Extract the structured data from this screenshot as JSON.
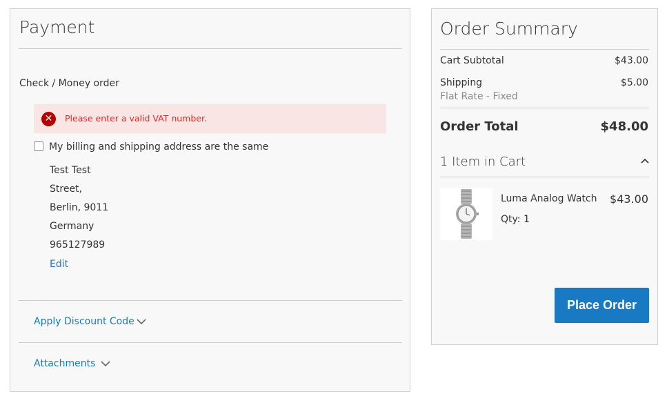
{
  "payment": {
    "title": "Payment",
    "method_label": "Check / Money order",
    "error_message": "Please enter a valid VAT number.",
    "same_address_label": "My billing and shipping address are the same",
    "same_address_checked": false,
    "address_lines": [
      "Test Test",
      "Street,",
      "Berlin, 9011",
      "Germany",
      "965127989"
    ],
    "edit_label": "Edit",
    "discount_label": "Apply Discount Code",
    "attachments_label": "Attachments"
  },
  "summary": {
    "title": "Order Summary",
    "subtotal_label": "Cart Subtotal",
    "subtotal_value": "$43.00",
    "shipping_label": "Shipping",
    "shipping_method": "Flat Rate - Fixed",
    "shipping_value": "$5.00",
    "total_label": "Order Total",
    "total_value": "$48.00",
    "items_label": "1 Item in Cart",
    "item": {
      "name": "Luma Analog Watch",
      "price": "$43.00",
      "qty": "Qty: 1"
    },
    "place_order_label": "Place Order"
  },
  "colors": {
    "accent": "#1979c3",
    "error_bg": "#fae5e5",
    "error_text": "#e02b27",
    "error_icon": "#b30000"
  }
}
